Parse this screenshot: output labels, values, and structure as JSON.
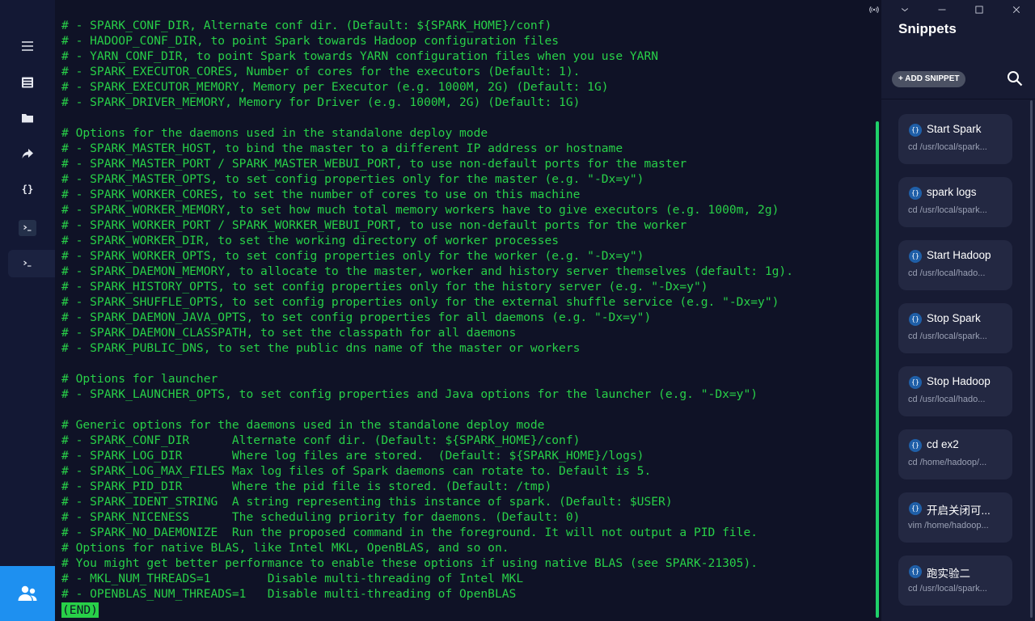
{
  "nav": {
    "items": [
      {
        "name": "menu-icon"
      },
      {
        "name": "hosts-icon"
      },
      {
        "name": "sftp-folder-icon"
      },
      {
        "name": "port-forwarding-icon"
      },
      {
        "name": "snippets-braces-icon"
      },
      {
        "name": "terminal-icon"
      },
      {
        "name": "active-terminal-icon"
      }
    ],
    "braces_glyph": "{}",
    "bottom_icon": "team-users-icon",
    "accent_color": "#1e90f0"
  },
  "terminal": {
    "text_color": "#28d048",
    "background": "#0f1226",
    "lines": [
      "# - SPARK_CONF_DIR, Alternate conf dir. (Default: ${SPARK_HOME}/conf)",
      "# - HADOOP_CONF_DIR, to point Spark towards Hadoop configuration files",
      "# - YARN_CONF_DIR, to point Spark towards YARN configuration files when you use YARN",
      "# - SPARK_EXECUTOR_CORES, Number of cores for the executors (Default: 1).",
      "# - SPARK_EXECUTOR_MEMORY, Memory per Executor (e.g. 1000M, 2G) (Default: 1G)",
      "# - SPARK_DRIVER_MEMORY, Memory for Driver (e.g. 1000M, 2G) (Default: 1G)",
      "",
      "# Options for the daemons used in the standalone deploy mode",
      "# - SPARK_MASTER_HOST, to bind the master to a different IP address or hostname",
      "# - SPARK_MASTER_PORT / SPARK_MASTER_WEBUI_PORT, to use non-default ports for the master",
      "# - SPARK_MASTER_OPTS, to set config properties only for the master (e.g. \"-Dx=y\")",
      "# - SPARK_WORKER_CORES, to set the number of cores to use on this machine",
      "# - SPARK_WORKER_MEMORY, to set how much total memory workers have to give executors (e.g. 1000m, 2g)",
      "# - SPARK_WORKER_PORT / SPARK_WORKER_WEBUI_PORT, to use non-default ports for the worker",
      "# - SPARK_WORKER_DIR, to set the working directory of worker processes",
      "# - SPARK_WORKER_OPTS, to set config properties only for the worker (e.g. \"-Dx=y\")",
      "# - SPARK_DAEMON_MEMORY, to allocate to the master, worker and history server themselves (default: 1g).",
      "# - SPARK_HISTORY_OPTS, to set config properties only for the history server (e.g. \"-Dx=y\")",
      "# - SPARK_SHUFFLE_OPTS, to set config properties only for the external shuffle service (e.g. \"-Dx=y\")",
      "# - SPARK_DAEMON_JAVA_OPTS, to set config properties for all daemons (e.g. \"-Dx=y\")",
      "# - SPARK_DAEMON_CLASSPATH, to set the classpath for all daemons",
      "# - SPARK_PUBLIC_DNS, to set the public dns name of the master or workers",
      "",
      "# Options for launcher",
      "# - SPARK_LAUNCHER_OPTS, to set config properties and Java options for the launcher (e.g. \"-Dx=y\")",
      "",
      "# Generic options for the daemons used in the standalone deploy mode",
      "# - SPARK_CONF_DIR      Alternate conf dir. (Default: ${SPARK_HOME}/conf)",
      "# - SPARK_LOG_DIR       Where log files are stored.  (Default: ${SPARK_HOME}/logs)",
      "# - SPARK_LOG_MAX_FILES Max log files of Spark daemons can rotate to. Default is 5.",
      "# - SPARK_PID_DIR       Where the pid file is stored. (Default: /tmp)",
      "# - SPARK_IDENT_STRING  A string representing this instance of spark. (Default: $USER)",
      "# - SPARK_NICENESS      The scheduling priority for daemons. (Default: 0)",
      "# - SPARK_NO_DAEMONIZE  Run the proposed command in the foreground. It will not output a PID file.",
      "# Options for native BLAS, like Intel MKL, OpenBLAS, and so on.",
      "# You might get better performance to enable these options if using native BLAS (see SPARK-21305).",
      "# - MKL_NUM_THREADS=1        Disable multi-threading of Intel MKL",
      "# - OPENBLAS_NUM_THREADS=1   Disable multi-threading of OpenBLAS"
    ],
    "end_marker": "(END)",
    "scrollbar_color": "#1fd06a"
  },
  "snippets": {
    "title": "Snippets",
    "add_label": "+ ADD SNIPPET",
    "search_icon": "search-icon",
    "window_controls": [
      "broadcast-icon",
      "chevron-down-icon",
      "minimize-icon",
      "maximize-icon",
      "close-icon"
    ],
    "item_icon": "{}",
    "items": [
      {
        "title": "Start Spark",
        "command": "cd /usr/local/spark..."
      },
      {
        "title": "spark logs",
        "command": "cd /usr/local/spark..."
      },
      {
        "title": "Start Hadoop",
        "command": "cd /usr/local/hado..."
      },
      {
        "title": "Stop Spark",
        "command": "cd /usr/local/spark..."
      },
      {
        "title": "Stop Hadoop",
        "command": "cd /usr/local/hado..."
      },
      {
        "title": "cd ex2",
        "command": "cd /home/hadoop/..."
      },
      {
        "title": "开启关闭可...",
        "command": "vim /home/hadoop..."
      },
      {
        "title": "跑实验二",
        "command": "cd /usr/local/spark..."
      }
    ]
  }
}
